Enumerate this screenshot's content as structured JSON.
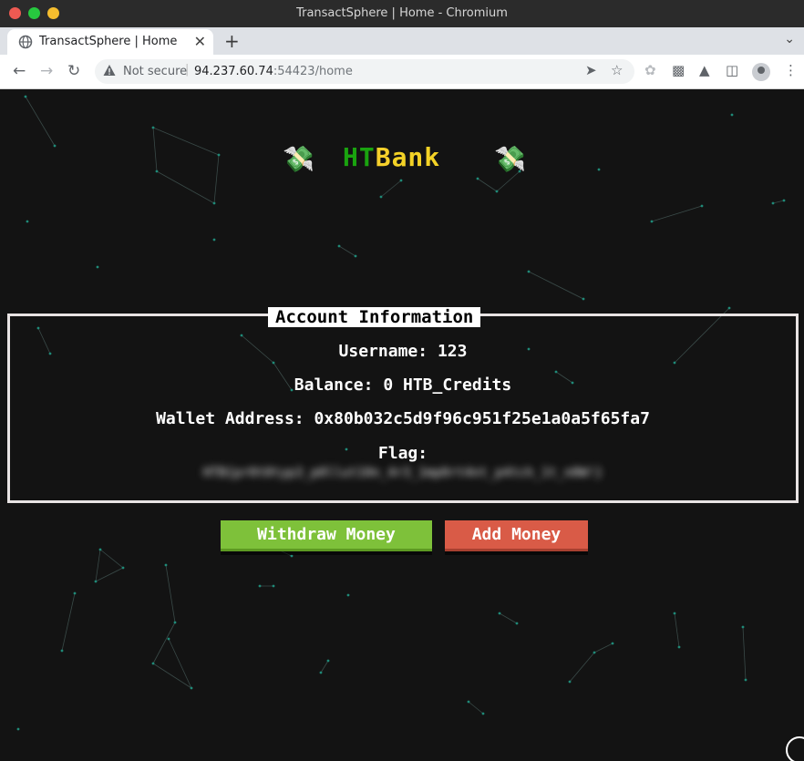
{
  "window": {
    "title": "TransactSphere | Home - Chromium"
  },
  "tab": {
    "title": "TransactSphere | Home",
    "close": "✕",
    "new_tab": "+"
  },
  "address_bar": {
    "security_label": "Not secure",
    "host": "94.237.60.74",
    "rest": ":54423/home"
  },
  "page": {
    "logo": {
      "part1": "HT",
      "part2": "B",
      "part3": "ank"
    },
    "money_icon": "💸",
    "account_info": {
      "heading": "Account Information",
      "username_label": "Username:",
      "username": "123",
      "balance_label": "Balance:",
      "balance": "0 HTB_Credits",
      "wallet_label": "Wallet Address:",
      "wallet": "0x80b032c5d9f96c951f25e1a0a5f65fa7",
      "flag_label": "Flag:",
      "flag_blurred": "HTB{pr0t0typ3_p0llut10n_4r3_1mp0rt4nt_p4tch_1t_n0W!}"
    },
    "buttons": {
      "withdraw": "Withdraw Money",
      "add": "Add Money"
    }
  },
  "colors": {
    "background": "#131313",
    "logo_green": "#1aa30f",
    "logo_yellow": "#f3d226",
    "withdraw_bg": "#7ec13a",
    "add_bg": "#d95b47",
    "network_dots": "#1f8a78"
  },
  "icons": {
    "back": "arrow-left-icon",
    "forward": "arrow-right-icon",
    "reload": "reload-icon",
    "warning": "warning-icon",
    "share": "share-icon",
    "bookmark": "star-icon",
    "extensions": "puzzle-icon",
    "labs": "flask-icon",
    "side_panel": "side-panel-icon",
    "profile": "profile-icon",
    "menu": "kebab-menu-icon"
  }
}
